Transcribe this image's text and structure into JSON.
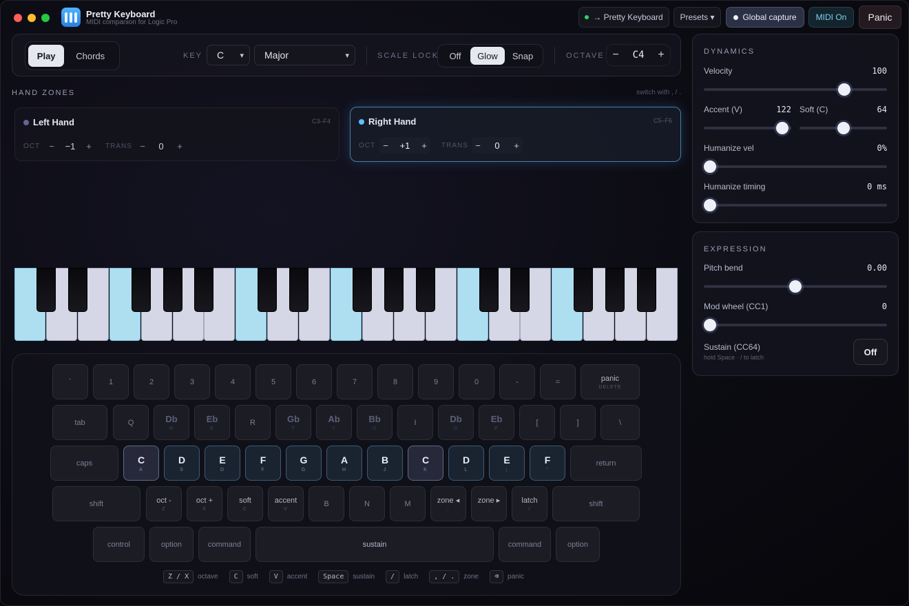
{
  "app": {
    "title": "Pretty Keyboard",
    "subtitle": "MIDI companion for Logic Pro",
    "icon": "keyboard-app-icon"
  },
  "titlebar": {
    "output_label": "→ Pretty Keyboard",
    "presets_label": "Presets ▾",
    "global_capture_label": "Global capture",
    "midi_label": "MIDI On",
    "panic_label": "Panic"
  },
  "toolbar": {
    "mode_tabs": [
      "Play",
      "Chords"
    ],
    "active_mode": "Play",
    "key_label": "KEY",
    "key_value": "C",
    "scale_value": "Major",
    "scale_lock_label": "SCALE LOCK",
    "scale_lock_options": [
      "Off",
      "Glow",
      "Snap"
    ],
    "scale_lock_active": "Glow",
    "octave_label": "OCTAVE",
    "octave_value": "C4",
    "minus": "−",
    "plus": "+"
  },
  "hand_zones": {
    "title": "HAND ZONES",
    "hint": "switch with , / .",
    "zones": [
      {
        "name": "Left Hand",
        "range": "C3–F4",
        "oct_label": "OCT",
        "oct_value": "−1",
        "trans_label": "TRANS",
        "trans_value": "0",
        "selected": false
      },
      {
        "name": "Right Hand",
        "range": "C5–F6",
        "oct_label": "OCT",
        "oct_value": "+1",
        "trans_label": "TRANS",
        "trans_value": "0",
        "selected": true
      }
    ]
  },
  "keyboard": {
    "rows": [
      [
        {
          "m": "`"
        },
        {
          "m": "1"
        },
        {
          "m": "2"
        },
        {
          "m": "3"
        },
        {
          "m": "4"
        },
        {
          "m": "5"
        },
        {
          "m": "6"
        },
        {
          "m": "7"
        },
        {
          "m": "8"
        },
        {
          "m": "9"
        },
        {
          "m": "0"
        },
        {
          "m": "-"
        },
        {
          "m": "="
        },
        {
          "m": "panic",
          "s": "DELETE"
        }
      ],
      [
        {
          "m": "tab"
        },
        {
          "m": "Q"
        },
        {
          "m": "Db",
          "s": "W"
        },
        {
          "m": "Eb",
          "s": "E"
        },
        {
          "m": "R"
        },
        {
          "m": "Gb",
          "s": "T"
        },
        {
          "m": "Ab",
          "s": "Y"
        },
        {
          "m": "Bb",
          "s": "U"
        },
        {
          "m": "I"
        },
        {
          "m": "Db",
          "s": "O"
        },
        {
          "m": "Eb",
          "s": "P"
        },
        {
          "m": "["
        },
        {
          "m": "]"
        },
        {
          "m": "\\"
        }
      ],
      [
        {
          "m": "caps"
        },
        {
          "m": "C",
          "s": "A"
        },
        {
          "m": "D",
          "s": "S"
        },
        {
          "m": "E",
          "s": "D"
        },
        {
          "m": "F",
          "s": "F"
        },
        {
          "m": "G",
          "s": "G"
        },
        {
          "m": "A",
          "s": "H"
        },
        {
          "m": "B",
          "s": "J"
        },
        {
          "m": "C",
          "s": "K"
        },
        {
          "m": "D",
          "s": "L"
        },
        {
          "m": "E",
          "s": ";"
        },
        {
          "m": "F",
          "s": "'"
        },
        {
          "m": "return"
        }
      ],
      [
        {
          "m": "shift"
        },
        {
          "m": "oct -",
          "s": "Z"
        },
        {
          "m": "oct +",
          "s": "X"
        },
        {
          "m": "soft",
          "s": "C"
        },
        {
          "m": "accent",
          "s": "V"
        },
        {
          "m": "B"
        },
        {
          "m": "N"
        },
        {
          "m": "M"
        },
        {
          "m": "zone ◂",
          "s": ","
        },
        {
          "m": "zone ▸",
          "s": "."
        },
        {
          "m": "latch",
          "s": "/"
        },
        {
          "m": "shift"
        }
      ],
      [
        {
          "m": "control"
        },
        {
          "m": "option"
        },
        {
          "m": "command"
        },
        {
          "m": "sustain"
        },
        {
          "m": "command"
        },
        {
          "m": "option"
        }
      ]
    ],
    "legend": [
      {
        "key": "Z / X",
        "label": "octave"
      },
      {
        "key": "C",
        "label": "soft"
      },
      {
        "key": "V",
        "label": "accent"
      },
      {
        "key": "Space",
        "label": "sustain"
      },
      {
        "key": "/",
        "label": "latch"
      },
      {
        "key": ", / .",
        "label": "zone"
      },
      {
        "key": "⌫",
        "label": "panic"
      }
    ]
  },
  "dynamics": {
    "title": "DYNAMICS",
    "velocity": {
      "label": "Velocity",
      "value": "100",
      "level": 100,
      "max": 127
    },
    "accent": {
      "label": "Accent (V)",
      "value": "122",
      "level": 122,
      "max": 127
    },
    "soft": {
      "label": "Soft (C)",
      "value": "64",
      "level": 64,
      "max": 127
    },
    "humanize_vel": {
      "label": "Humanize vel",
      "value": "0%",
      "level": 0,
      "max": 100
    },
    "humanize_timing": {
      "label": "Humanize timing",
      "value": "0 ms",
      "level": 0,
      "max": 100
    }
  },
  "expression": {
    "title": "EXPRESSION",
    "pitch_bend": {
      "label": "Pitch bend",
      "value": "0.00",
      "level": 0,
      "min": -1,
      "max": 1
    },
    "mod_wheel": {
      "label": "Mod wheel (CC1)",
      "value": "0",
      "level": 0,
      "max": 127
    },
    "sustain": {
      "label": "Sustain (CC64)",
      "hint": "hold Space · / to latch",
      "button": "Off"
    }
  },
  "piano": {
    "highlighted_keys": [
      "C",
      "F"
    ]
  },
  "colors": {
    "accent": "#4fb4ff",
    "active_green": "#2bd46a",
    "scale_glow": "#aedff0"
  }
}
